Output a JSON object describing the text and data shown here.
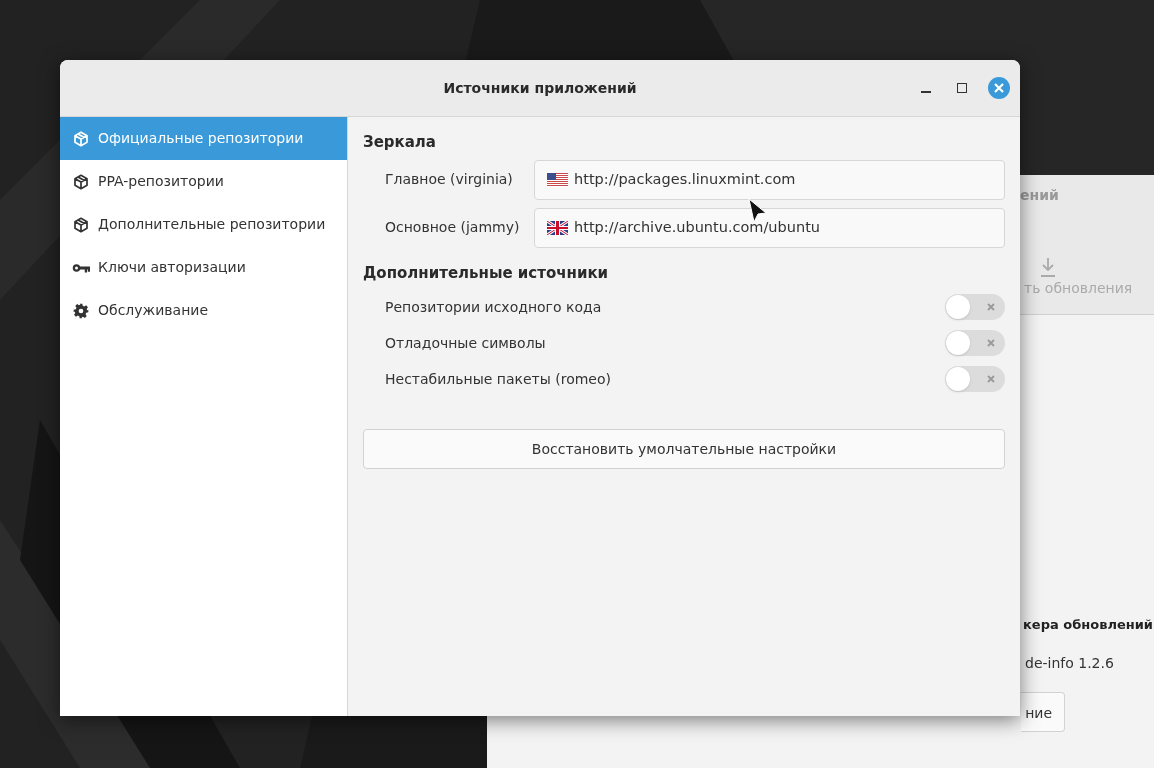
{
  "background_window": {
    "header_fragment": "ений",
    "toolbar_button": "ть обновления",
    "section_title": "кера обновлений",
    "version": "de-info 1.2.6",
    "button": "ние"
  },
  "window": {
    "title": "Источники приложений"
  },
  "sidebar": {
    "items": [
      {
        "label": "Официальные репозитории",
        "selected": true
      },
      {
        "label": "PPA-репозитории",
        "selected": false
      },
      {
        "label": "Дополнительные репозитории",
        "selected": false
      },
      {
        "label": "Ключи авторизации",
        "selected": false
      },
      {
        "label": "Обслуживание",
        "selected": false
      }
    ]
  },
  "mirrors": {
    "title": "Зеркала",
    "rows": [
      {
        "label": "Главное (virginia)",
        "value": "http://packages.linuxmint.com"
      },
      {
        "label": "Основное (jammy)",
        "value": "http://archive.ubuntu.com/ubuntu"
      }
    ]
  },
  "extra_sources": {
    "title": "Дополнительные источники",
    "rows": [
      {
        "label": "Репозитории исходного кода",
        "on": false
      },
      {
        "label": "Отладочные символы",
        "on": false
      },
      {
        "label": "Нестабильные пакеты (romeo)",
        "on": false
      }
    ]
  },
  "restore_button": "Восстановить умолчательные настройки"
}
